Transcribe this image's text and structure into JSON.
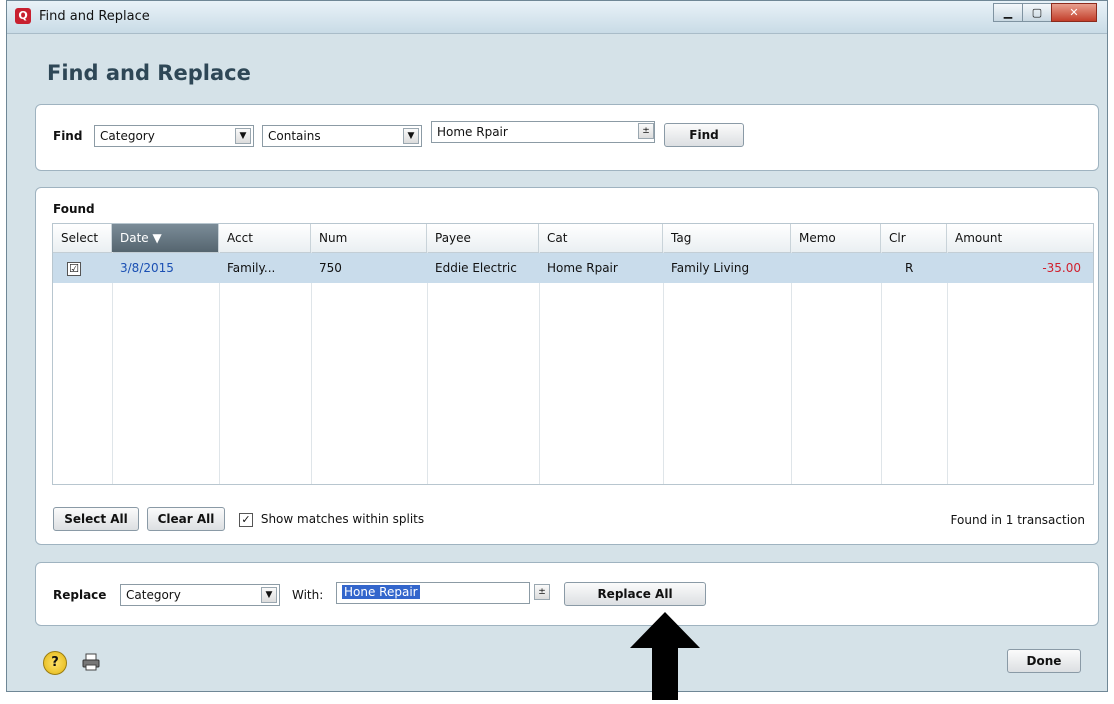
{
  "window": {
    "title": "Find and Replace",
    "app_icon": "Q",
    "minimize_icon": "minimize-icon",
    "maximize_icon": "maximize-icon",
    "close_icon": "close-icon"
  },
  "heading": "Find and Replace",
  "find": {
    "label": "Find",
    "field_value": "Category",
    "operator_value": "Contains",
    "search_value": "Home Rpair",
    "button_label": "Find"
  },
  "found": {
    "label": "Found",
    "columns": [
      "Select",
      "Date ▼",
      "Acct",
      "Num",
      "Payee",
      "Cat",
      "Tag",
      "Memo",
      "Clr",
      "Amount"
    ],
    "rows": [
      {
        "select": "☑",
        "date": "3/8/2015",
        "acct": "Family...",
        "num": "750",
        "payee": "Eddie Electric",
        "cat": "Home Rpair",
        "tag": "Family Living",
        "memo": "",
        "clr": "R",
        "amount": "-35.00"
      }
    ],
    "select_all_label": "Select All",
    "clear_all_label": "Clear All",
    "show_matches_label": "Show matches within splits",
    "show_matches_checked": true,
    "status": "Found in 1 transaction"
  },
  "replace": {
    "label": "Replace",
    "field_value": "Category",
    "with_label": "With:",
    "with_value": "Hone Repair",
    "button_label": "Replace All"
  },
  "footer": {
    "help_icon": "help-icon",
    "print_icon": "printer-icon",
    "done_label": "Done"
  },
  "colors": {
    "window_bg": "#d5e2e8",
    "selected_row": "#c9dceb",
    "amount_negative": "#d0202e",
    "date_link": "#1a4fb3",
    "highlight": "#3366cc"
  }
}
